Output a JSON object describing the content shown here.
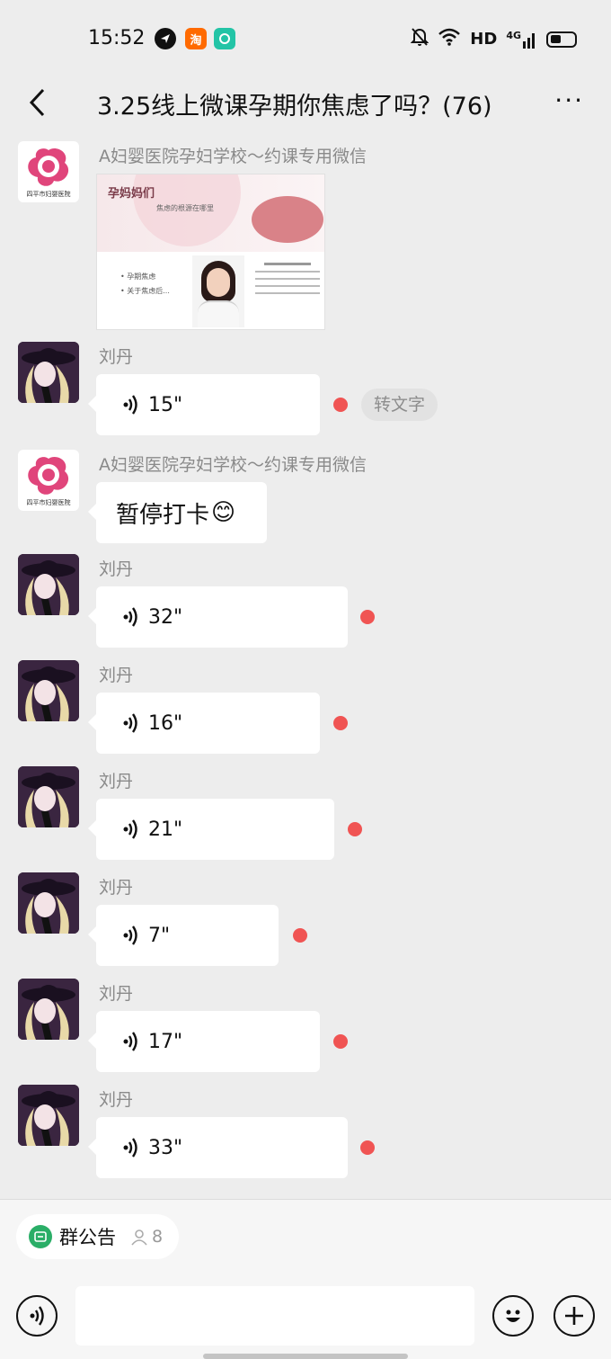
{
  "status_bar": {
    "time": "15:52",
    "app_icons": [
      "navigation-icon",
      "taobao-icon",
      "chat-app-icon"
    ],
    "taobao_glyph": "淘",
    "network_label": "HD",
    "signal_label": "4G"
  },
  "header": {
    "title": "3.25线上微课孕期你焦虑了吗？(76)",
    "more_glyph": "···"
  },
  "messages": [
    {
      "type": "image",
      "sender": "A妇婴医院孕妇学校～约课专用微信",
      "avatar": "hospital",
      "image": {
        "heading": "孕妈妈们",
        "subheading": "焦虑的根源在哪里",
        "bullets": [
          "• 孕期焦虑",
          "• 关于焦虑后..."
        ]
      }
    },
    {
      "type": "voice",
      "sender": "刘丹",
      "avatar": "liudan",
      "duration": "15\"",
      "convert_label": "转文字"
    },
    {
      "type": "text",
      "sender": "A妇婴医院孕妇学校～约课专用微信",
      "avatar": "hospital",
      "text": "暂停打卡",
      "emoji": "😊"
    },
    {
      "type": "voice",
      "sender": "刘丹",
      "avatar": "liudan",
      "duration": "32\""
    },
    {
      "type": "voice",
      "sender": "刘丹",
      "avatar": "liudan",
      "duration": "16\""
    },
    {
      "type": "voice",
      "sender": "刘丹",
      "avatar": "liudan",
      "duration": "21\""
    },
    {
      "type": "voice",
      "sender": "刘丹",
      "avatar": "liudan",
      "duration": "7\""
    },
    {
      "type": "voice",
      "sender": "刘丹",
      "avatar": "liudan",
      "duration": "17\""
    },
    {
      "type": "voice",
      "sender": "刘丹",
      "avatar": "liudan",
      "duration": "33\""
    }
  ],
  "hospital_avatar_caption": "四平市妇婴医院",
  "bottom": {
    "notice_label": "群公告",
    "notice_count": "8",
    "input_placeholder": ""
  },
  "colors": {
    "background": "#ededed",
    "unread_dot": "#f05453",
    "notice_green": "#2aae67",
    "hospital_pink": "#e0457b"
  }
}
